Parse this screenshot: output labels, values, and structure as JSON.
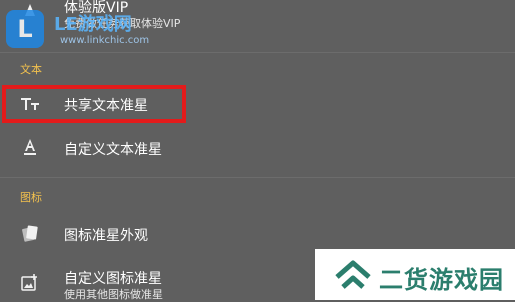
{
  "top_item": {
    "label": "体验版VIP",
    "subtitle": "免费做任务获取体验VIP"
  },
  "watermark": {
    "brand": "LE游戏网",
    "url": "www.linkchic.com",
    "logo_letter": "L"
  },
  "sections": {
    "text": "文本",
    "icon": "图标"
  },
  "items": {
    "share_text_crosshair": "共享文本准星",
    "custom_text_crosshair": "自定义文本准星",
    "icon_crosshair_appearance": "图标准星外观",
    "custom_icon_crosshair": "自定义图标准星",
    "custom_icon_crosshair_sub": "使用其他图标做准星"
  },
  "bottom_watermark": {
    "text": "二货游戏园"
  },
  "colors": {
    "background": "#5f5f5f",
    "section_title": "#f2c14e",
    "highlight": "#e31b1b",
    "brand": "#2b7e6d"
  }
}
